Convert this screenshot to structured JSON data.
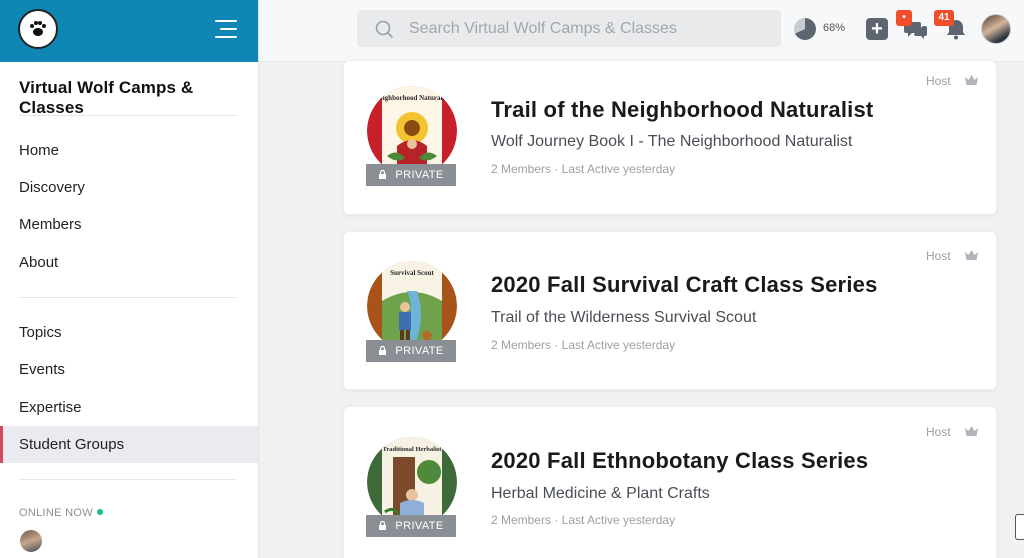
{
  "sidebar": {
    "site_title": "Virtual Wolf Camps & Classes",
    "nav_primary": [
      {
        "label": "Home"
      },
      {
        "label": "Discovery"
      },
      {
        "label": "Members"
      },
      {
        "label": "About"
      }
    ],
    "nav_secondary": [
      {
        "label": "Topics"
      },
      {
        "label": "Events"
      },
      {
        "label": "Expertise"
      },
      {
        "label": "Student Groups"
      }
    ],
    "online_label": "ONLINE NOW"
  },
  "topbar": {
    "search_placeholder": "Search Virtual Wolf Camps & Classes",
    "profile_progress": "68%",
    "messages_badge": "•",
    "notifications_badge": "41"
  },
  "groups": [
    {
      "title": "Trail of the Neighborhood Naturalist",
      "subtitle": "Wolf Journey Book I - The Neighborhood Naturalist",
      "meta": "2 Members · Last Active yesterday",
      "role": "Host",
      "privacy": "PRIVATE",
      "avatar_text": "Neighborhood Naturalist"
    },
    {
      "title": "2020 Fall Survival Craft Class Series",
      "subtitle": "Trail of the Wilderness Survival Scout",
      "meta": "2 Members · Last Active yesterday",
      "role": "Host",
      "privacy": "PRIVATE",
      "avatar_text": "Survival Scout"
    },
    {
      "title": "2020 Fall Ethnobotany Class Series",
      "subtitle": "Herbal Medicine & Plant Crafts",
      "meta": "2 Members · Last Active yesterday",
      "role": "Host",
      "privacy": "PRIVATE",
      "avatar_text": "Traditional Herbalist"
    }
  ],
  "colors": {
    "header_blue": "#0f87b5",
    "badge_orange": "#ee4e29",
    "online_green": "#14c37a",
    "active_indicator": "#d24b5a"
  }
}
